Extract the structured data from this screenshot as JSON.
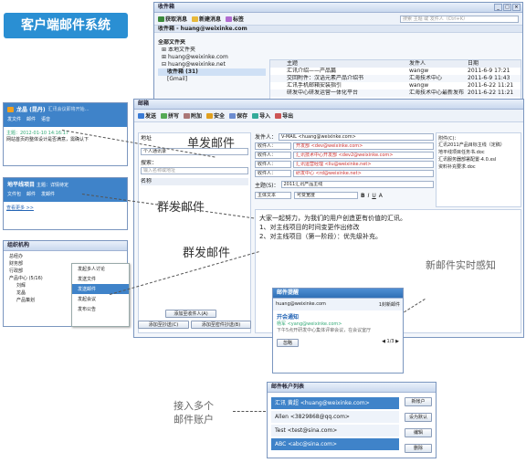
{
  "badge": {
    "label": "客户端邮件系统"
  },
  "inbox": {
    "title": "收件箱",
    "toolbar": [
      "获取消息",
      "新建消息",
      "标签"
    ],
    "search_placeholder": "搜索 主题 或 发件人（Ctrl+K）",
    "tab": "收件箱 - huang@weixinke.com",
    "sidebar_title": "全部文件夹",
    "folders": [
      "本地文件夹",
      "huang@weixinke.com",
      "huang@weixinke.net",
      "收件箱 (31)",
      "[Gmail]"
    ],
    "columns": [
      "主题",
      "发件人",
      "日期"
    ],
    "rows": [
      {
        "subject": "汇讯介绍——产品篇",
        "from": "wangw",
        "date": "2011-6-9 17:21"
      },
      {
        "subject": "交回附件：汉语元素产品介绍书",
        "from": "汇海技术中心",
        "date": "2011-6-9 11:43"
      },
      {
        "subject": "汇讯手机邮箱安装指引",
        "from": "wangw",
        "date": "2011-6-22 11:21"
      },
      {
        "subject": "研发中心研发运营一体化平台",
        "from": "汇海技术中心最新发布",
        "date": "2011-6-22 11:21"
      }
    ]
  },
  "im": {
    "title": "龙晶 (昆丹)",
    "status": "汇讯会议即将开始…",
    "tabs": [
      "发文件",
      "邮件",
      "语音"
    ],
    "line1": "主题：2012-01-10 14:16:17",
    "line2": "网站首页的整体设计是否满意，需确认下",
    "project": "地平线项目",
    "project_sub": "主题：详情待定",
    "project_tabs": [
      "文件包",
      "邮件",
      "发邮件"
    ],
    "project_link": "查看更多 >>",
    "contacts_title": "组织机构",
    "contacts": [
      "总经办",
      "财务部",
      "行政部",
      "产品中心 (5/16)",
      "刘辉",
      "龙晶",
      "产品策划"
    ],
    "context_menu": [
      "发起多人讨论",
      "发送文件",
      "发送邮件",
      "发起会议",
      "发布公告"
    ]
  },
  "compose": {
    "title": "邮箱",
    "toolbar": [
      "发送",
      "拼写",
      "附加",
      "安全",
      "保存",
      "导入",
      "导出"
    ],
    "address_label": "地址",
    "address_book": "个人通讯录",
    "search_label": "搜索：",
    "search_placeholder": "输入名称或地址",
    "name_col": "名称",
    "sender_label": "发件人：",
    "sender_value": "V-MAIL <huang@weixinke.com>",
    "recipients": [
      {
        "type": "收件人：",
        "name": "开发部 <dev@weixinke.com>",
        "value": "开发部 <dev@weixinke.com>"
      },
      {
        "type": "收件人：",
        "name": "汇讯技术中心开发部 <dev2@weixinke.com>",
        "value": "汇讯技术中心开发部 <dev2@weixinke.com>"
      },
      {
        "type": "收件人：",
        "name": "汇讯运营经理 <liu@weixinke.net>",
        "value": "汇讯运营经理 <liu@weixinke.net>"
      },
      {
        "type": "收件人：",
        "name": "研发中心 <rd@weixinke.net>",
        "value": "研发中心 <rd@weixinke.net>"
      }
    ],
    "subject_label": "主题(S)：",
    "subject_value": "2011汇讯产品主线",
    "format": "主体文本",
    "font": "可变宽度",
    "body": [
      "大家一起努力，为我们的用户创造更有价值的汇讯。",
      "1、对主线项目的时间变更作出修改",
      "2、对主线项目（第一阶段）：优先级补充。"
    ],
    "attach_label": "附件(C)：",
    "attachments": [
      "汇讯2011产品目标主线（定稿）",
      "地平线项目任务书.doc",
      "汇讯服务器部署配置-4.0.xsl",
      "资料补充要求.doc"
    ],
    "btn_add_to": "添加至收件人(A)",
    "btn_add_cc": "添加至抄送(C)",
    "btn_add_bcc": "添加至密件抄送(B)"
  },
  "annotations": {
    "single": "单发邮件",
    "group1": "群发邮件",
    "group2": "群发邮件",
    "realtime": "新邮件实时感知",
    "multi_line1": "接入多个",
    "multi_line2": "邮件账户"
  },
  "notify": {
    "title": "邮件提醒",
    "account": "huang@weixinke.com",
    "count": "1封新邮件",
    "subject": "开会通知",
    "sender": "杨军 <yang@weixinke.com>",
    "preview": "下午5点开研发中心集体评审会议，在会议室厅",
    "action": "忽略",
    "page": "1/3"
  },
  "accounts": {
    "title": "邮件帐户列表",
    "items": [
      "汇讯 黄超 <huang@weixinke.com>",
      "Allen <3829868@qq.com>",
      "Test <test@sina.com>",
      "ABC <abc@sina.com>"
    ],
    "buttons": [
      "新帐户",
      "设为默认",
      "编辑",
      "删除"
    ]
  }
}
